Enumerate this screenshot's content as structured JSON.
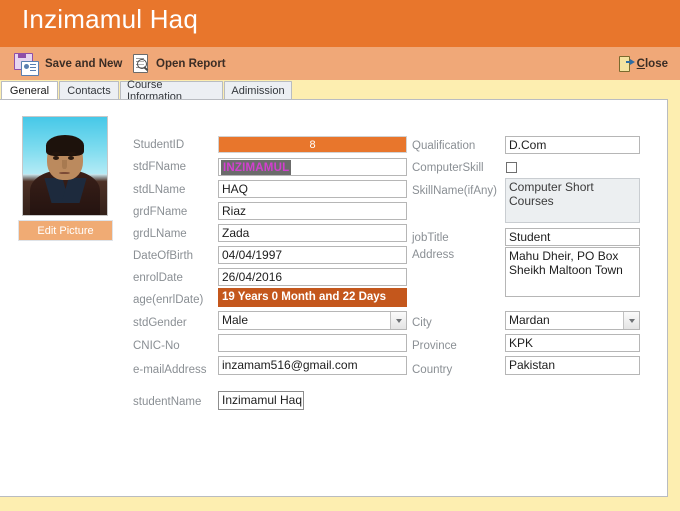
{
  "window": {
    "title": "Inzimamul Haq",
    "title_bar_color": "#e8762c",
    "toolbar_color": "#f0a878",
    "page_background": "#fdeeb0"
  },
  "toolbar": {
    "save_and_new_label": "Save and New",
    "open_report_label": "Open Report",
    "close_label_prefix": "",
    "close_label_accel": "C",
    "close_label_rest": "lose"
  },
  "tabs": [
    {
      "label": "General",
      "active": true
    },
    {
      "label": "Contacts",
      "active": false
    },
    {
      "label": "Course Information",
      "active": false
    },
    {
      "label": "Adimission",
      "active": false
    }
  ],
  "photo": {
    "edit_button_label": "Edit Picture"
  },
  "left_column": [
    {
      "label": "StudentID",
      "value": "8",
      "type": "readonly-orange"
    },
    {
      "label": "stdFName",
      "value": "INZIMAMUL",
      "type": "text-selected"
    },
    {
      "label": "stdLName",
      "value": "HAQ",
      "type": "text"
    },
    {
      "label": "grdFName",
      "value": "Riaz",
      "type": "text"
    },
    {
      "label": "grdLName",
      "value": "Zada",
      "type": "text"
    },
    {
      "label": "DateOfBirth",
      "value": "04/04/1997",
      "type": "text"
    },
    {
      "label": "enrolDate",
      "value": "26/04/2016",
      "type": "text"
    },
    {
      "label": "age(enrlDate)",
      "value": "19 Years 0 Month and 22 Days",
      "type": "readonly-dark"
    },
    {
      "label": "stdGender",
      "value": "Male",
      "type": "combo"
    },
    {
      "label": "CNIC-No",
      "value": "",
      "type": "text"
    },
    {
      "label": "e-mailAddress",
      "value": "inzamam516@gmail.com",
      "type": "text"
    }
  ],
  "right_column": [
    {
      "label": "Qualification",
      "value": "D.Com",
      "type": "text"
    },
    {
      "label": "ComputerSkill",
      "value": "",
      "type": "checkbox",
      "checked": false
    },
    {
      "label": "SkillName(ifAny)",
      "value": "Computer Short Courses",
      "type": "textarea-disabled"
    },
    {
      "label": "jobTitle",
      "value": "Student",
      "type": "text"
    },
    {
      "label": "Address",
      "value": "Mahu Dheir, PO Box Sheikh Maltoon Town",
      "type": "textarea"
    },
    {
      "label": "City",
      "value": "Mardan",
      "type": "combo"
    },
    {
      "label": "Province",
      "value": "KPK",
      "type": "text"
    },
    {
      "label": "Country",
      "value": "Pakistan",
      "type": "text"
    }
  ],
  "bottom_field": {
    "label": "studentName",
    "value": "Inzimamul Haq"
  }
}
